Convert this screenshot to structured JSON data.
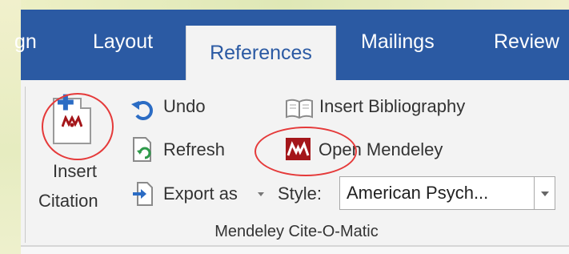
{
  "tabs": [
    {
      "label": "gn"
    },
    {
      "label": "Layout"
    },
    {
      "label": "References",
      "active": true
    },
    {
      "label": "Mailings"
    },
    {
      "label": "Review"
    }
  ],
  "ribbon": {
    "insert_citation": {
      "line1": "Insert",
      "line2": "Citation",
      "icon": "mendeley-document-icon"
    },
    "undo": {
      "label": "Undo",
      "icon": "undo-icon"
    },
    "refresh": {
      "label": "Refresh",
      "icon": "refresh-icon"
    },
    "export": {
      "label": "Export as",
      "icon": "export-icon"
    },
    "insert_bibliography": {
      "label": "Insert Bibliography",
      "icon": "bibliography-icon"
    },
    "open_mendeley": {
      "label": "Open Mendeley",
      "icon": "mendeley-icon"
    },
    "style": {
      "label": "Style:",
      "value": "American Psych..."
    },
    "group_label": "Mendeley Cite-O-Matic"
  },
  "colors": {
    "tab_bar": "#2b5aa3",
    "ribbon_bg": "#f3f3f3",
    "mendeley_red": "#a4161a",
    "annotation_circle": "#e53a3a"
  }
}
